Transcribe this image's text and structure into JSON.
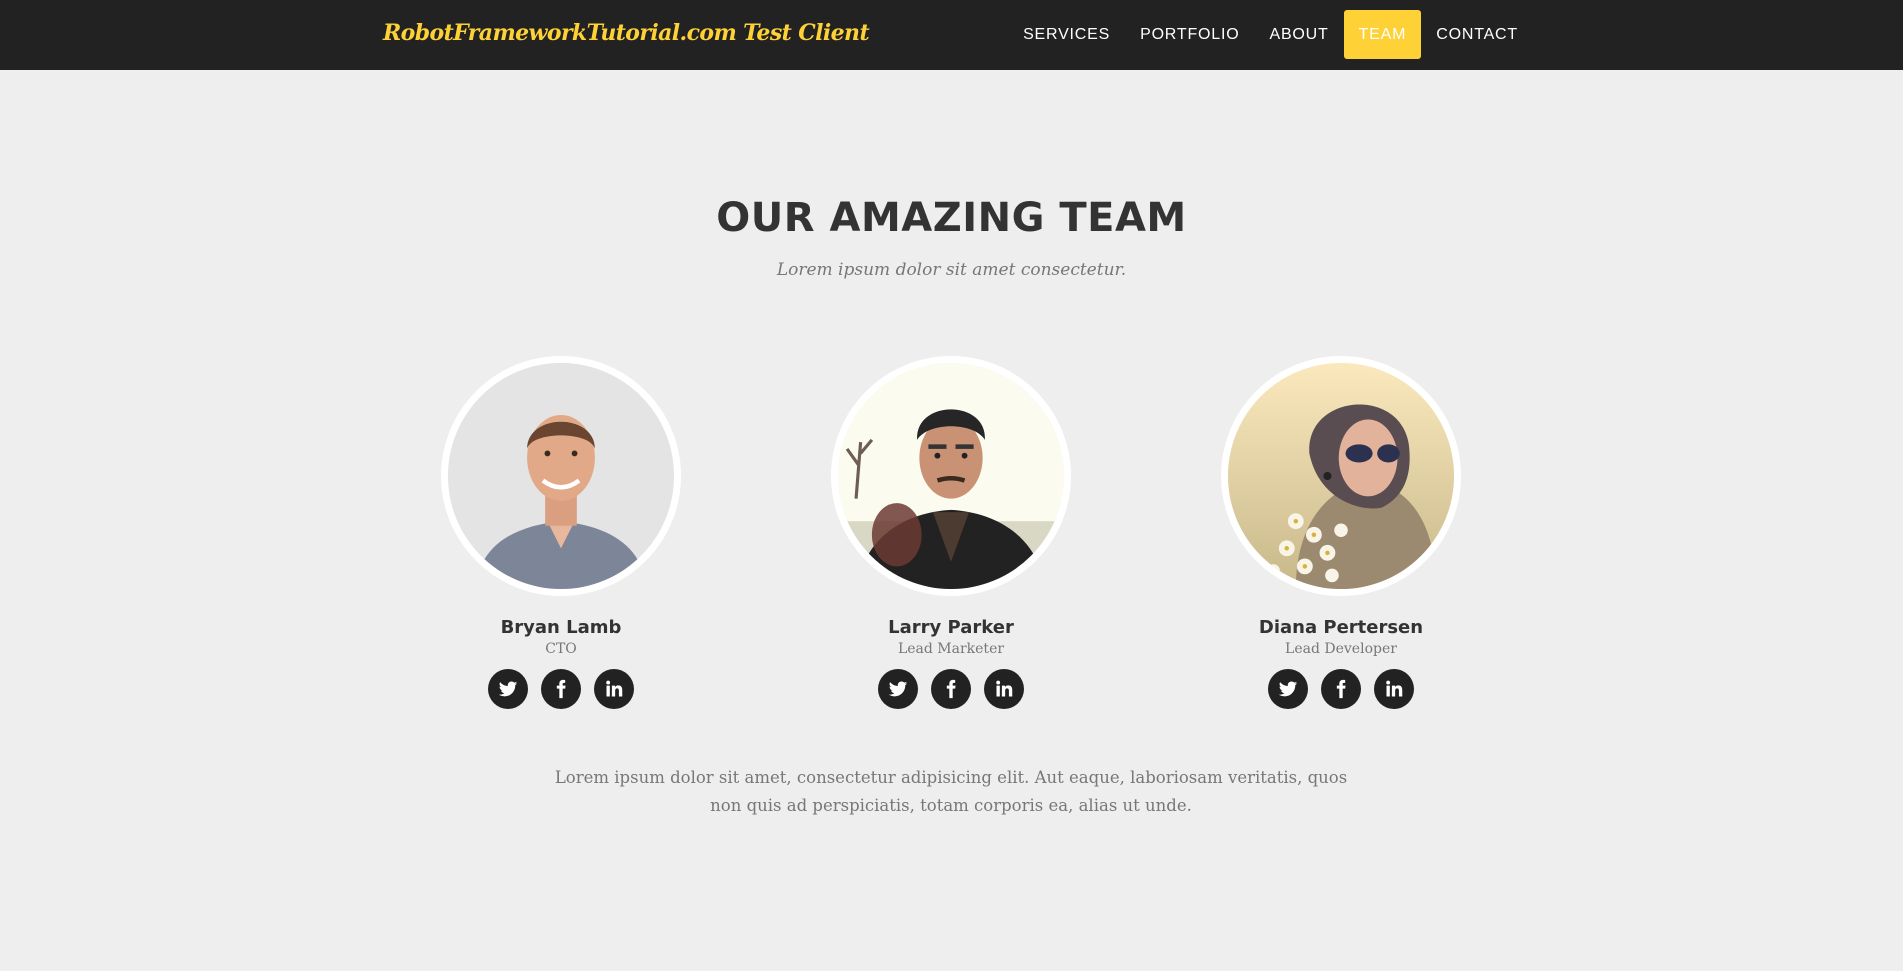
{
  "navbar": {
    "brand": "RobotFrameworkTutorial.com Test Client",
    "items": [
      {
        "label": "Services",
        "active": false
      },
      {
        "label": "Portfolio",
        "active": false
      },
      {
        "label": "About",
        "active": false
      },
      {
        "label": "Team",
        "active": true
      },
      {
        "label": "Contact",
        "active": false
      }
    ]
  },
  "team": {
    "title": "Our Amazing Team",
    "subtitle": "Lorem ipsum dolor sit amet consectetur.",
    "members": [
      {
        "name": "Bryan Lamb",
        "role": "CTO"
      },
      {
        "name": "Larry Parker",
        "role": "Lead Marketer"
      },
      {
        "name": "Diana Pertersen",
        "role": "Lead Developer"
      }
    ],
    "social_icons": [
      "twitter-icon",
      "facebook-icon",
      "linkedin-icon"
    ],
    "blurb": "Lorem ipsum dolor sit amet, consectetur adipisicing elit. Aut eaque, laboriosam veritatis, quos non quis ad perspiciatis, totam corporis ea, alias ut unde."
  },
  "colors": {
    "accent": "#fed136",
    "navbar_bg": "#222222",
    "page_bg": "#eeeeee",
    "social_bg": "#222222"
  }
}
